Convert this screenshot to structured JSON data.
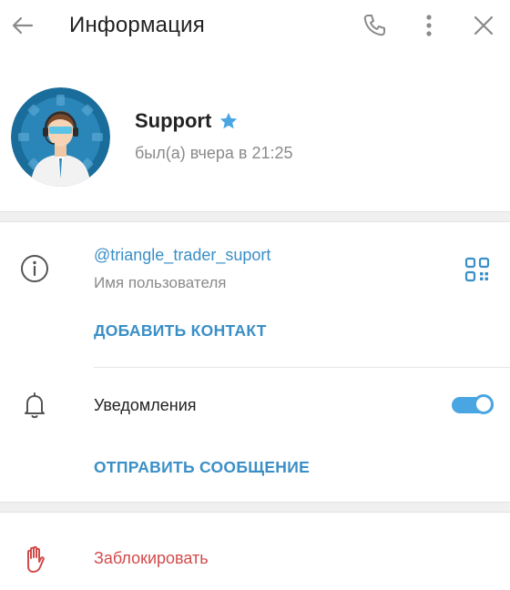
{
  "header": {
    "title": "Информация",
    "back_icon": "arrow-left-icon",
    "phone_icon": "phone-icon",
    "more_icon": "more-vertical-icon",
    "close_icon": "close-icon"
  },
  "profile": {
    "name": "Support",
    "status": "был(а) вчера в 21:25",
    "verified_icon": "star-icon",
    "avatar_color": "#1a6d9a"
  },
  "info": {
    "username": "@triangle_trader_suport",
    "username_caption": "Имя пользователя",
    "add_contact_label": "ДОБАВИТЬ КОНТАКТ",
    "notifications_label": "Уведомления",
    "notifications_enabled": true,
    "send_message_label": "ОТПРАВИТЬ СООБЩЕНИЕ",
    "block_label": "Заблокировать"
  },
  "colors": {
    "accent": "#3a8fc7",
    "toggle": "#4aa6e3",
    "danger": "#d24b4b",
    "star": "#4aa6e3"
  }
}
